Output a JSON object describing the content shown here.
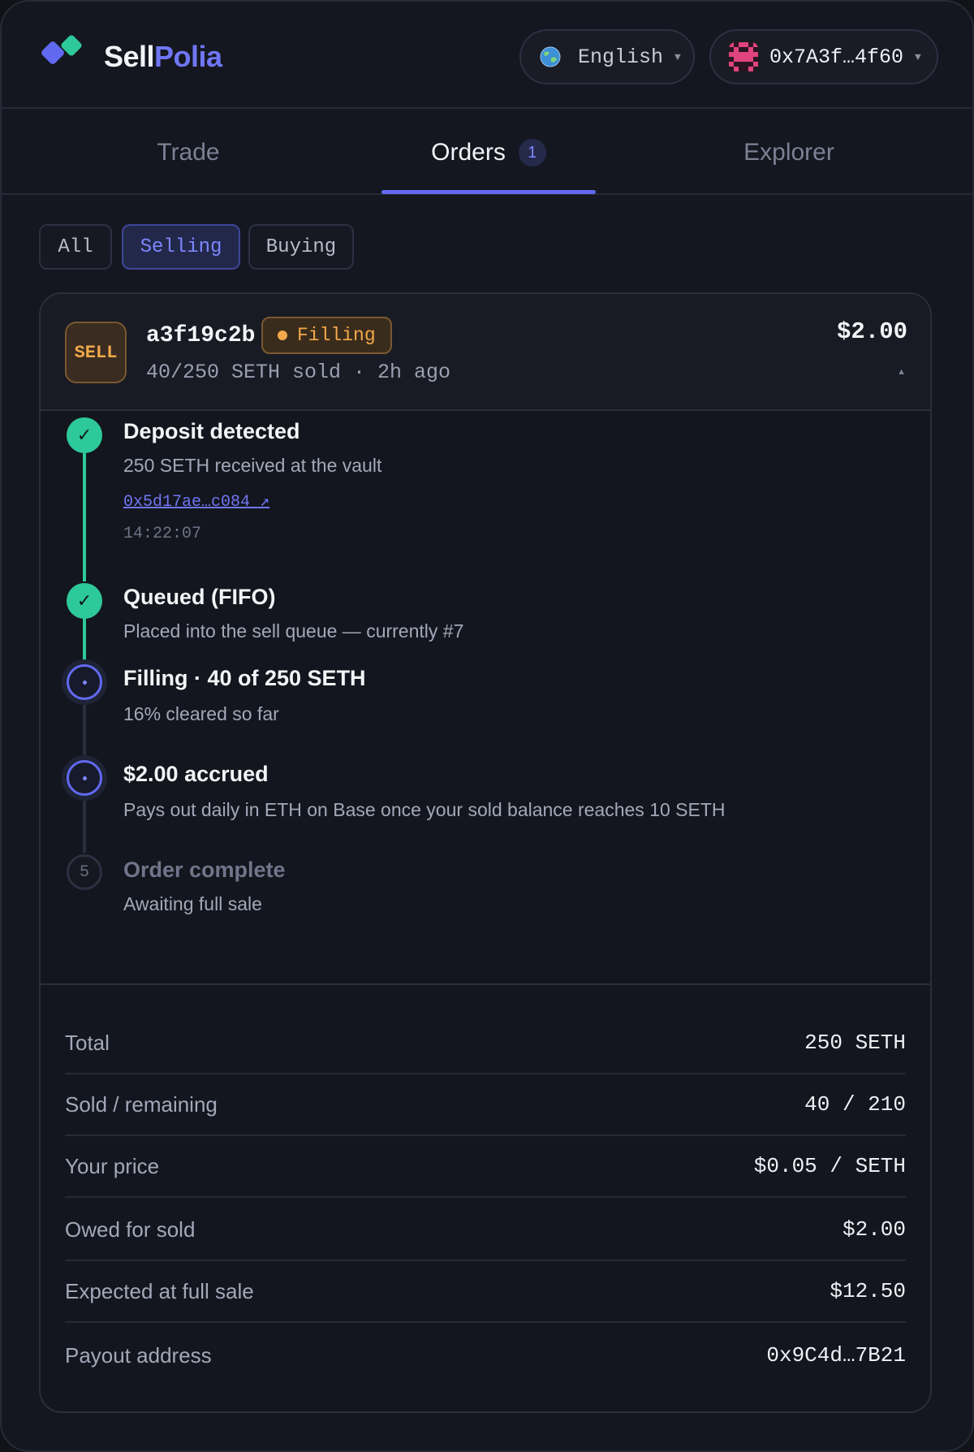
{
  "header": {
    "brand_part1": "Sell",
    "brand_part2": "Polia",
    "language": "English",
    "wallet_address": "0x7A3f…4f60",
    "icons": {
      "logo": "sellpolia-logo",
      "language": "globe-icon",
      "wallet": "wallet-avatar"
    }
  },
  "tabs": {
    "trade": "Trade",
    "orders": "Orders",
    "orders_count": "1",
    "explorer": "Explorer",
    "active": "Orders"
  },
  "filters": {
    "all": "All",
    "selling": "Selling",
    "buying": "Buying",
    "active": "Selling"
  },
  "order": {
    "side_tag": "SELL",
    "id": "a3f19c2b",
    "status": "Filling",
    "summary": "40/250 SETH sold · 2h ago",
    "amount": "$2.00",
    "timeline": [
      {
        "title": "Deposit detected",
        "desc": "250 SETH received at the vault",
        "link": "0x5d17ae…c084 ↗",
        "time": "14:22:07",
        "state": "done"
      },
      {
        "title": "Queued (FIFO)",
        "desc": "Placed into the sell queue — currently #7",
        "state": "done"
      },
      {
        "title": "Filling · 40 of 250 SETH",
        "desc": "16% cleared so far",
        "state": "active"
      },
      {
        "title": "$2.00 accrued",
        "desc": "Pays out daily in ETH on Base once your sold balance reaches 10 SETH",
        "state": "active"
      },
      {
        "number": "5",
        "title": "Order complete",
        "desc": "Awaiting full sale",
        "state": "pending"
      }
    ],
    "details": [
      {
        "label": "Total",
        "value": "250 SETH"
      },
      {
        "label": "Sold / remaining",
        "value": "40 / 210"
      },
      {
        "label": "Your price",
        "value": "$0.05 / SETH"
      },
      {
        "label": "Owed for sold",
        "value": "$2.00"
      },
      {
        "label": "Expected at full sale",
        "value": "$12.50"
      },
      {
        "label": "Payout address",
        "value": "0x9C4d…7B21"
      }
    ]
  },
  "colors": {
    "accent": "#6169f0",
    "success": "#2ec99b",
    "warning": "#f2a94b",
    "background": "#141720"
  }
}
